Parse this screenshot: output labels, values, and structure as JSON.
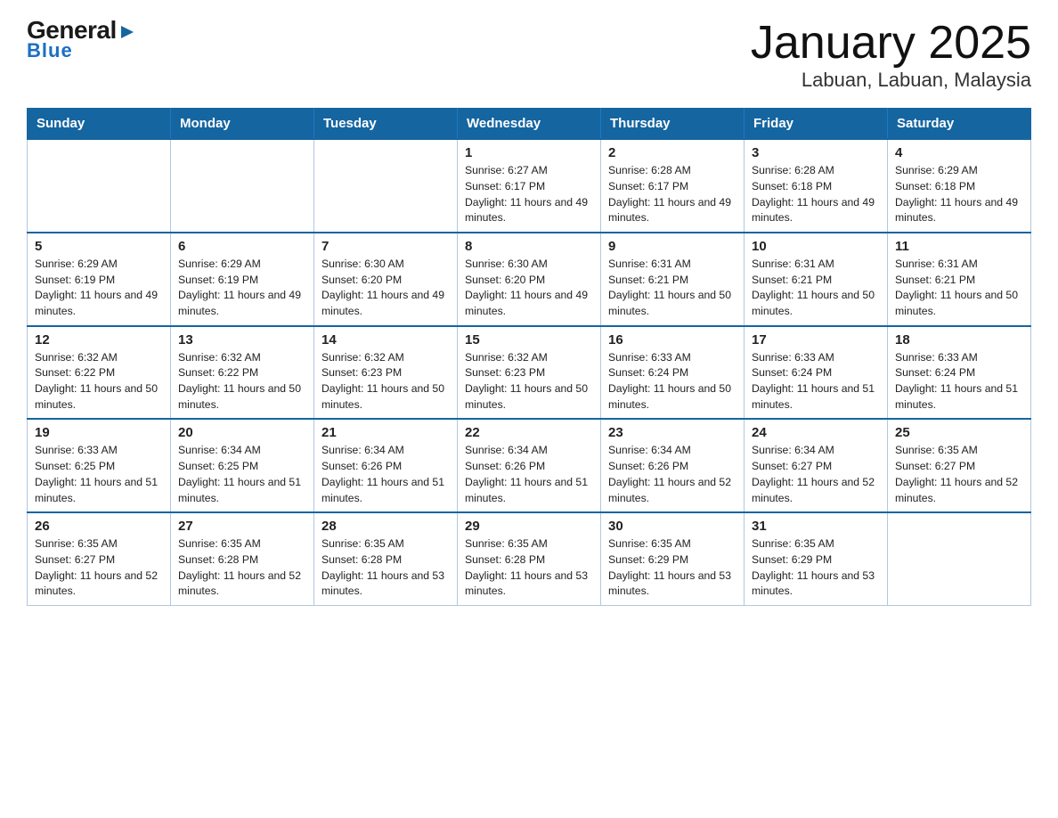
{
  "logo": {
    "general": "General",
    "blue": "Blue"
  },
  "title": "January 2025",
  "subtitle": "Labuan, Labuan, Malaysia",
  "days_of_week": [
    "Sunday",
    "Monday",
    "Tuesday",
    "Wednesday",
    "Thursday",
    "Friday",
    "Saturday"
  ],
  "weeks": [
    [
      {
        "day": "",
        "info": ""
      },
      {
        "day": "",
        "info": ""
      },
      {
        "day": "",
        "info": ""
      },
      {
        "day": "1",
        "info": "Sunrise: 6:27 AM\nSunset: 6:17 PM\nDaylight: 11 hours and 49 minutes."
      },
      {
        "day": "2",
        "info": "Sunrise: 6:28 AM\nSunset: 6:17 PM\nDaylight: 11 hours and 49 minutes."
      },
      {
        "day": "3",
        "info": "Sunrise: 6:28 AM\nSunset: 6:18 PM\nDaylight: 11 hours and 49 minutes."
      },
      {
        "day": "4",
        "info": "Sunrise: 6:29 AM\nSunset: 6:18 PM\nDaylight: 11 hours and 49 minutes."
      }
    ],
    [
      {
        "day": "5",
        "info": "Sunrise: 6:29 AM\nSunset: 6:19 PM\nDaylight: 11 hours and 49 minutes."
      },
      {
        "day": "6",
        "info": "Sunrise: 6:29 AM\nSunset: 6:19 PM\nDaylight: 11 hours and 49 minutes."
      },
      {
        "day": "7",
        "info": "Sunrise: 6:30 AM\nSunset: 6:20 PM\nDaylight: 11 hours and 49 minutes."
      },
      {
        "day": "8",
        "info": "Sunrise: 6:30 AM\nSunset: 6:20 PM\nDaylight: 11 hours and 49 minutes."
      },
      {
        "day": "9",
        "info": "Sunrise: 6:31 AM\nSunset: 6:21 PM\nDaylight: 11 hours and 50 minutes."
      },
      {
        "day": "10",
        "info": "Sunrise: 6:31 AM\nSunset: 6:21 PM\nDaylight: 11 hours and 50 minutes."
      },
      {
        "day": "11",
        "info": "Sunrise: 6:31 AM\nSunset: 6:21 PM\nDaylight: 11 hours and 50 minutes."
      }
    ],
    [
      {
        "day": "12",
        "info": "Sunrise: 6:32 AM\nSunset: 6:22 PM\nDaylight: 11 hours and 50 minutes."
      },
      {
        "day": "13",
        "info": "Sunrise: 6:32 AM\nSunset: 6:22 PM\nDaylight: 11 hours and 50 minutes."
      },
      {
        "day": "14",
        "info": "Sunrise: 6:32 AM\nSunset: 6:23 PM\nDaylight: 11 hours and 50 minutes."
      },
      {
        "day": "15",
        "info": "Sunrise: 6:32 AM\nSunset: 6:23 PM\nDaylight: 11 hours and 50 minutes."
      },
      {
        "day": "16",
        "info": "Sunrise: 6:33 AM\nSunset: 6:24 PM\nDaylight: 11 hours and 50 minutes."
      },
      {
        "day": "17",
        "info": "Sunrise: 6:33 AM\nSunset: 6:24 PM\nDaylight: 11 hours and 51 minutes."
      },
      {
        "day": "18",
        "info": "Sunrise: 6:33 AM\nSunset: 6:24 PM\nDaylight: 11 hours and 51 minutes."
      }
    ],
    [
      {
        "day": "19",
        "info": "Sunrise: 6:33 AM\nSunset: 6:25 PM\nDaylight: 11 hours and 51 minutes."
      },
      {
        "day": "20",
        "info": "Sunrise: 6:34 AM\nSunset: 6:25 PM\nDaylight: 11 hours and 51 minutes."
      },
      {
        "day": "21",
        "info": "Sunrise: 6:34 AM\nSunset: 6:26 PM\nDaylight: 11 hours and 51 minutes."
      },
      {
        "day": "22",
        "info": "Sunrise: 6:34 AM\nSunset: 6:26 PM\nDaylight: 11 hours and 51 minutes."
      },
      {
        "day": "23",
        "info": "Sunrise: 6:34 AM\nSunset: 6:26 PM\nDaylight: 11 hours and 52 minutes."
      },
      {
        "day": "24",
        "info": "Sunrise: 6:34 AM\nSunset: 6:27 PM\nDaylight: 11 hours and 52 minutes."
      },
      {
        "day": "25",
        "info": "Sunrise: 6:35 AM\nSunset: 6:27 PM\nDaylight: 11 hours and 52 minutes."
      }
    ],
    [
      {
        "day": "26",
        "info": "Sunrise: 6:35 AM\nSunset: 6:27 PM\nDaylight: 11 hours and 52 minutes."
      },
      {
        "day": "27",
        "info": "Sunrise: 6:35 AM\nSunset: 6:28 PM\nDaylight: 11 hours and 52 minutes."
      },
      {
        "day": "28",
        "info": "Sunrise: 6:35 AM\nSunset: 6:28 PM\nDaylight: 11 hours and 53 minutes."
      },
      {
        "day": "29",
        "info": "Sunrise: 6:35 AM\nSunset: 6:28 PM\nDaylight: 11 hours and 53 minutes."
      },
      {
        "day": "30",
        "info": "Sunrise: 6:35 AM\nSunset: 6:29 PM\nDaylight: 11 hours and 53 minutes."
      },
      {
        "day": "31",
        "info": "Sunrise: 6:35 AM\nSunset: 6:29 PM\nDaylight: 11 hours and 53 minutes."
      },
      {
        "day": "",
        "info": ""
      }
    ]
  ]
}
